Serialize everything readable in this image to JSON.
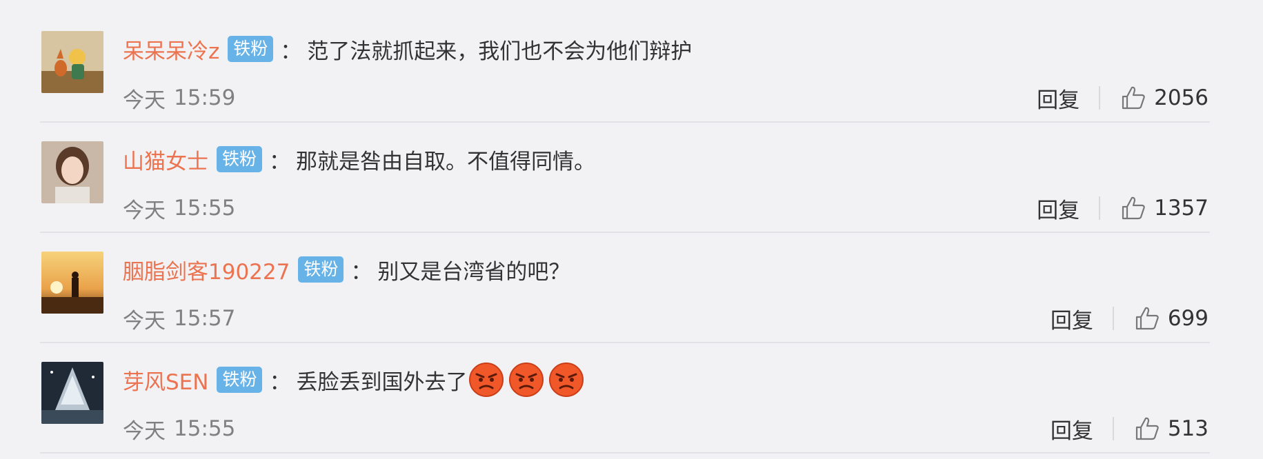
{
  "comments": [
    {
      "username": "呆呆呆冷z",
      "badge": "铁粉",
      "separator": "：",
      "content": "范了法就抓起来，我们也不会为他们辩护",
      "time_prefix": "今天",
      "time": "15:59",
      "reply_label": "回复",
      "likes": "2056",
      "avatar": "avatar-little-prince"
    },
    {
      "username": "山猫女士",
      "badge": "铁粉",
      "separator": "：",
      "content": "那就是咎由自取。不值得同情。",
      "time_prefix": "今天",
      "time": "15:55",
      "reply_label": "回复",
      "likes": "1357",
      "avatar": "avatar-woman-portrait"
    },
    {
      "username": "胭脂剑客190227",
      "badge": "铁粉",
      "separator": "：",
      "content": "别又是台湾省的吧？",
      "time_prefix": "今天",
      "time": "15:57",
      "reply_label": "回复",
      "likes": "699",
      "avatar": "avatar-sunset-rider"
    },
    {
      "username": "芽风SEN",
      "badge": "铁粉",
      "separator": "：",
      "content": "丢脸丢到国外去了",
      "emojis": [
        "angry-face-emoji",
        "angry-face-emoji",
        "angry-face-emoji"
      ],
      "time_prefix": "今天",
      "time": "15:55",
      "reply_label": "回复",
      "likes": "513",
      "avatar": "avatar-night-tree"
    }
  ],
  "colors": {
    "background": "#f2f2f5",
    "username": "#eb7350",
    "badge": "#67b2e6",
    "time": "#808080"
  }
}
